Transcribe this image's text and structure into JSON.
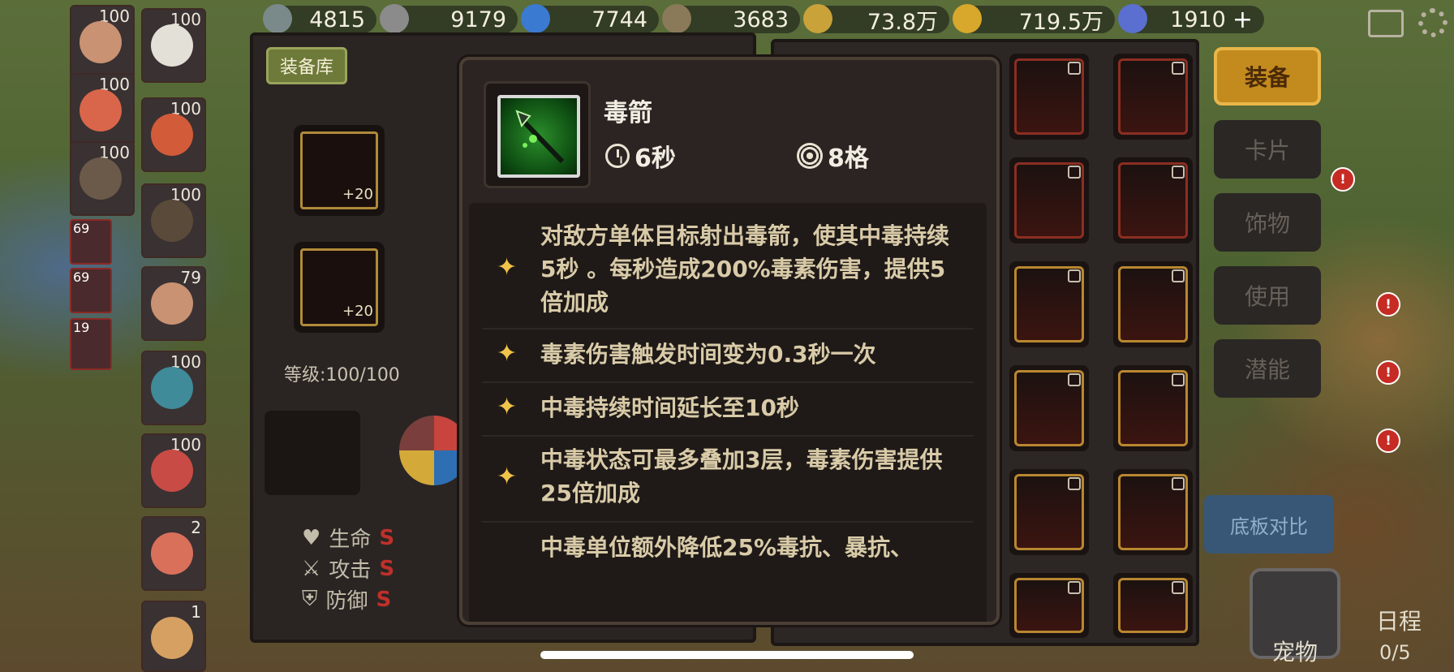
{
  "resources": [
    {
      "name": "resource-1",
      "value": "4815",
      "color": "#7a8a8a"
    },
    {
      "name": "resource-2",
      "value": "9179",
      "color": "#8b8b8b"
    },
    {
      "name": "crystal",
      "value": "7744",
      "color": "#3a7ad1"
    },
    {
      "name": "resource-4",
      "value": "3683",
      "color": "#8a7a5a"
    },
    {
      "name": "wheat",
      "value": "73.8万",
      "color": "#c9a23a"
    },
    {
      "name": "gold-coin",
      "value": "719.5万",
      "color": "#d8a82c"
    },
    {
      "name": "diamond",
      "value": "1910",
      "color": "#5a6fd0"
    }
  ],
  "heroes_left": [
    {
      "level": "100"
    },
    {
      "level": "100"
    },
    {
      "level": "100"
    },
    {
      "level": "69"
    },
    {
      "level": "69"
    },
    {
      "level": "19"
    }
  ],
  "heroes_right": [
    {
      "level": "100"
    },
    {
      "level": "100"
    },
    {
      "level": "100"
    },
    {
      "level": "79"
    },
    {
      "level": "100"
    },
    {
      "level": "100"
    },
    {
      "level": "2"
    },
    {
      "level": "1"
    }
  ],
  "panel": {
    "tag": "装备库",
    "slot1_plus": "+20",
    "slot2_plus": "+20",
    "level_text": "等级:100/100",
    "stats": [
      {
        "label": "生命",
        "grade": "S"
      },
      {
        "label": "攻击",
        "grade": "S"
      },
      {
        "label": "防御",
        "grade": "S"
      }
    ]
  },
  "sidemenu": {
    "equip": "装备",
    "card": "卡片",
    "accessory": "饰物",
    "use": "使用",
    "potential": "潜能",
    "compare": "底板对比"
  },
  "bottom_nav": {
    "pet": "宠物",
    "schedule": "日程",
    "schedule_count": "0/5"
  },
  "tooltip": {
    "name": "毒箭",
    "cooldown": "6秒",
    "range": "8格",
    "entries": [
      {
        "text": "对敌方单体目标射出毒箭，使其中毒持续5秒 。每秒造成200%毒素伤害，提供5倍加成"
      },
      {
        "text": "毒素伤害触发时间变为0.3秒一次"
      },
      {
        "text": "中毒持续时间延长至10秒"
      },
      {
        "text": "中毒状态可最多叠加3层，毒素伤害提供25倍加成"
      },
      {
        "text": "中毒单位额外降低25%毒抗、暴抗、"
      }
    ]
  }
}
